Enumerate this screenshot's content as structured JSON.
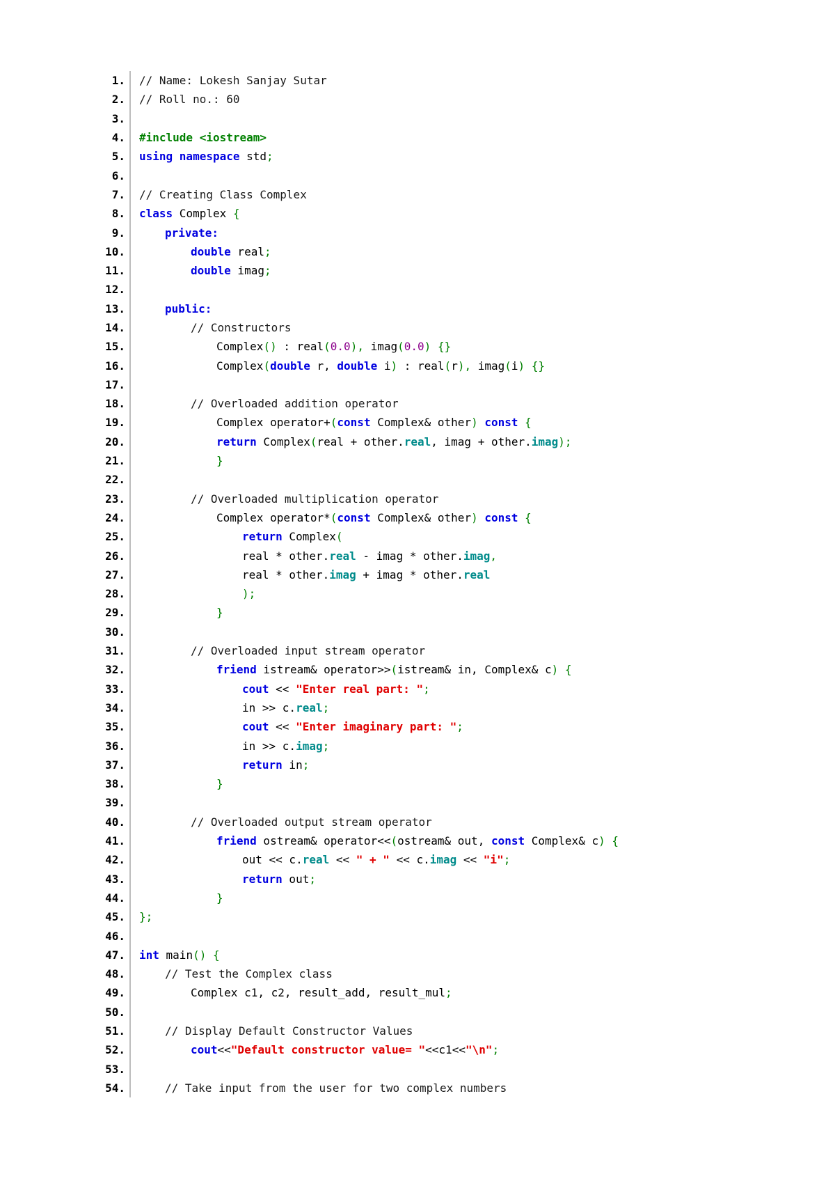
{
  "colors": {
    "plain": "#000000",
    "comment": "#1a1a1a",
    "keyword": "#0000e0",
    "bracket": "#008000",
    "string": "#e00000",
    "number": "#8b008b",
    "member": "#008b8b",
    "directive": "#008000"
  },
  "code": {
    "lines": [
      {
        "n": "1.",
        "indent": 0,
        "tokens": [
          {
            "t": "// Name: Lokesh Sanjay Sutar",
            "c": "comment"
          }
        ]
      },
      {
        "n": "2.",
        "indent": 0,
        "tokens": [
          {
            "t": "// Roll no.: 60",
            "c": "comment"
          }
        ]
      },
      {
        "n": "3.",
        "indent": 0,
        "tokens": []
      },
      {
        "n": "4.",
        "indent": 0,
        "tokens": [
          {
            "t": "#include <iostream>",
            "c": "directive",
            "b": true
          }
        ]
      },
      {
        "n": "5.",
        "indent": 0,
        "tokens": [
          {
            "t": "using namespace",
            "c": "keyword",
            "b": true
          },
          {
            "t": " std",
            "c": "plain"
          },
          {
            "t": ";",
            "c": "bracket"
          }
        ]
      },
      {
        "n": "6.",
        "indent": 0,
        "tokens": []
      },
      {
        "n": "7.",
        "indent": 0,
        "tokens": [
          {
            "t": "// Creating Class Complex",
            "c": "comment"
          }
        ]
      },
      {
        "n": "8.",
        "indent": 0,
        "tokens": [
          {
            "t": "class",
            "c": "keyword",
            "b": true
          },
          {
            "t": " Complex ",
            "c": "plain"
          },
          {
            "t": "{",
            "c": "bracket"
          }
        ]
      },
      {
        "n": "9.",
        "indent": 1,
        "tokens": [
          {
            "t": "private:",
            "c": "keyword",
            "b": true
          }
        ]
      },
      {
        "n": "10.",
        "indent": 2,
        "tokens": [
          {
            "t": "double",
            "c": "keyword",
            "b": true
          },
          {
            "t": " real",
            "c": "plain"
          },
          {
            "t": ";",
            "c": "bracket"
          }
        ]
      },
      {
        "n": "11.",
        "indent": 2,
        "tokens": [
          {
            "t": "double",
            "c": "keyword",
            "b": true
          },
          {
            "t": " imag",
            "c": "plain"
          },
          {
            "t": ";",
            "c": "bracket"
          }
        ]
      },
      {
        "n": "12.",
        "indent": 0,
        "tokens": []
      },
      {
        "n": "13.",
        "indent": 1,
        "tokens": [
          {
            "t": "public:",
            "c": "keyword",
            "b": true
          }
        ]
      },
      {
        "n": "14.",
        "indent": 2,
        "tokens": [
          {
            "t": "// Constructors",
            "c": "comment"
          }
        ]
      },
      {
        "n": "15.",
        "indent": 3,
        "tokens": [
          {
            "t": "Complex",
            "c": "plain"
          },
          {
            "t": "()",
            "c": "bracket"
          },
          {
            "t": " : real",
            "c": "plain"
          },
          {
            "t": "(",
            "c": "bracket"
          },
          {
            "t": "0.0",
            "c": "number"
          },
          {
            "t": "),",
            "c": "bracket"
          },
          {
            "t": " imag",
            "c": "plain"
          },
          {
            "t": "(",
            "c": "bracket"
          },
          {
            "t": "0.0",
            "c": "number"
          },
          {
            "t": ") {}",
            "c": "bracket"
          }
        ]
      },
      {
        "n": "16.",
        "indent": 3,
        "tokens": [
          {
            "t": "Complex",
            "c": "plain"
          },
          {
            "t": "(",
            "c": "bracket"
          },
          {
            "t": "double",
            "c": "keyword",
            "b": true
          },
          {
            "t": " r, ",
            "c": "plain"
          },
          {
            "t": "double",
            "c": "keyword",
            "b": true
          },
          {
            "t": " i",
            "c": "plain"
          },
          {
            "t": ")",
            "c": "bracket"
          },
          {
            "t": " : real",
            "c": "plain"
          },
          {
            "t": "(",
            "c": "bracket"
          },
          {
            "t": "r",
            "c": "plain"
          },
          {
            "t": "),",
            "c": "bracket"
          },
          {
            "t": " imag",
            "c": "plain"
          },
          {
            "t": "(",
            "c": "bracket"
          },
          {
            "t": "i",
            "c": "plain"
          },
          {
            "t": ") {}",
            "c": "bracket"
          }
        ]
      },
      {
        "n": "17.",
        "indent": 0,
        "tokens": []
      },
      {
        "n": "18.",
        "indent": 2,
        "tokens": [
          {
            "t": "// Overloaded addition operator",
            "c": "comment"
          }
        ]
      },
      {
        "n": "19.",
        "indent": 3,
        "tokens": [
          {
            "t": "Complex operator+",
            "c": "plain"
          },
          {
            "t": "(",
            "c": "bracket"
          },
          {
            "t": "const",
            "c": "keyword",
            "b": true
          },
          {
            "t": " Complex& other",
            "c": "plain"
          },
          {
            "t": ")",
            "c": "bracket"
          },
          {
            "t": " ",
            "c": "plain"
          },
          {
            "t": "const",
            "c": "keyword",
            "b": true
          },
          {
            "t": " {",
            "c": "bracket"
          }
        ]
      },
      {
        "n": "20.",
        "indent": 3,
        "tokens": [
          {
            "t": "return",
            "c": "keyword",
            "b": true
          },
          {
            "t": " Complex",
            "c": "plain"
          },
          {
            "t": "(",
            "c": "bracket"
          },
          {
            "t": "real + other.",
            "c": "plain"
          },
          {
            "t": "real",
            "c": "member",
            "b": true
          },
          {
            "t": ", imag + other.",
            "c": "plain"
          },
          {
            "t": "imag",
            "c": "member",
            "b": true
          },
          {
            "t": ");",
            "c": "bracket"
          }
        ]
      },
      {
        "n": "21.",
        "indent": 3,
        "tokens": [
          {
            "t": "}",
            "c": "bracket"
          }
        ]
      },
      {
        "n": "22.",
        "indent": 0,
        "tokens": []
      },
      {
        "n": "23.",
        "indent": 2,
        "tokens": [
          {
            "t": "// Overloaded multiplication operator",
            "c": "comment"
          }
        ]
      },
      {
        "n": "24.",
        "indent": 3,
        "tokens": [
          {
            "t": "Complex operator*",
            "c": "plain"
          },
          {
            "t": "(",
            "c": "bracket"
          },
          {
            "t": "const",
            "c": "keyword",
            "b": true
          },
          {
            "t": " Complex& other",
            "c": "plain"
          },
          {
            "t": ")",
            "c": "bracket"
          },
          {
            "t": " ",
            "c": "plain"
          },
          {
            "t": "const",
            "c": "keyword",
            "b": true
          },
          {
            "t": " {",
            "c": "bracket"
          }
        ]
      },
      {
        "n": "25.",
        "indent": 4,
        "tokens": [
          {
            "t": "return",
            "c": "keyword",
            "b": true
          },
          {
            "t": " Complex",
            "c": "plain"
          },
          {
            "t": "(",
            "c": "bracket"
          }
        ]
      },
      {
        "n": "26.",
        "indent": 4,
        "tokens": [
          {
            "t": "real * other.",
            "c": "plain"
          },
          {
            "t": "real",
            "c": "member",
            "b": true
          },
          {
            "t": " - imag * other.",
            "c": "plain"
          },
          {
            "t": "imag",
            "c": "member",
            "b": true
          },
          {
            "t": ",",
            "c": "bracket"
          }
        ]
      },
      {
        "n": "27.",
        "indent": 4,
        "tokens": [
          {
            "t": "real * other.",
            "c": "plain"
          },
          {
            "t": "imag",
            "c": "member",
            "b": true
          },
          {
            "t": " + imag * other.",
            "c": "plain"
          },
          {
            "t": "real",
            "c": "member",
            "b": true
          }
        ]
      },
      {
        "n": "28.",
        "indent": 4,
        "tokens": [
          {
            "t": ");",
            "c": "bracket"
          }
        ]
      },
      {
        "n": "29.",
        "indent": 3,
        "tokens": [
          {
            "t": "}",
            "c": "bracket"
          }
        ]
      },
      {
        "n": "30.",
        "indent": 0,
        "tokens": []
      },
      {
        "n": "31.",
        "indent": 2,
        "tokens": [
          {
            "t": "// Overloaded input stream operator",
            "c": "comment"
          }
        ]
      },
      {
        "n": "32.",
        "indent": 3,
        "tokens": [
          {
            "t": "friend",
            "c": "keyword",
            "b": true
          },
          {
            "t": " istream& operator>>",
            "c": "plain"
          },
          {
            "t": "(",
            "c": "bracket"
          },
          {
            "t": "istream& in, Complex& c",
            "c": "plain"
          },
          {
            "t": ") {",
            "c": "bracket"
          }
        ]
      },
      {
        "n": "33.",
        "indent": 4,
        "tokens": [
          {
            "t": "cout",
            "c": "keyword",
            "b": true
          },
          {
            "t": " << ",
            "c": "plain"
          },
          {
            "t": "\"Enter real part: \"",
            "c": "string",
            "b": true
          },
          {
            "t": ";",
            "c": "bracket"
          }
        ]
      },
      {
        "n": "34.",
        "indent": 4,
        "tokens": [
          {
            "t": "in >> c.",
            "c": "plain"
          },
          {
            "t": "real",
            "c": "member",
            "b": true
          },
          {
            "t": ";",
            "c": "bracket"
          }
        ]
      },
      {
        "n": "35.",
        "indent": 4,
        "tokens": [
          {
            "t": "cout",
            "c": "keyword",
            "b": true
          },
          {
            "t": " << ",
            "c": "plain"
          },
          {
            "t": "\"Enter imaginary part: \"",
            "c": "string",
            "b": true
          },
          {
            "t": ";",
            "c": "bracket"
          }
        ]
      },
      {
        "n": "36.",
        "indent": 4,
        "tokens": [
          {
            "t": "in >> c.",
            "c": "plain"
          },
          {
            "t": "imag",
            "c": "member",
            "b": true
          },
          {
            "t": ";",
            "c": "bracket"
          }
        ]
      },
      {
        "n": "37.",
        "indent": 4,
        "tokens": [
          {
            "t": "return",
            "c": "keyword",
            "b": true
          },
          {
            "t": " in",
            "c": "plain"
          },
          {
            "t": ";",
            "c": "bracket"
          }
        ]
      },
      {
        "n": "38.",
        "indent": 3,
        "tokens": [
          {
            "t": "}",
            "c": "bracket"
          }
        ]
      },
      {
        "n": "39.",
        "indent": 0,
        "tokens": []
      },
      {
        "n": "40.",
        "indent": 2,
        "tokens": [
          {
            "t": "// Overloaded output stream operator",
            "c": "comment"
          }
        ]
      },
      {
        "n": "41.",
        "indent": 3,
        "tokens": [
          {
            "t": "friend",
            "c": "keyword",
            "b": true
          },
          {
            "t": " ostream& operator<<",
            "c": "plain"
          },
          {
            "t": "(",
            "c": "bracket"
          },
          {
            "t": "ostream& out, ",
            "c": "plain"
          },
          {
            "t": "const",
            "c": "keyword",
            "b": true
          },
          {
            "t": " Complex& c",
            "c": "plain"
          },
          {
            "t": ") {",
            "c": "bracket"
          }
        ]
      },
      {
        "n": "42.",
        "indent": 4,
        "tokens": [
          {
            "t": "out << c.",
            "c": "plain"
          },
          {
            "t": "real",
            "c": "member",
            "b": true
          },
          {
            "t": " << ",
            "c": "plain"
          },
          {
            "t": "\" + \"",
            "c": "string",
            "b": true
          },
          {
            "t": " << c.",
            "c": "plain"
          },
          {
            "t": "imag",
            "c": "member",
            "b": true
          },
          {
            "t": " << ",
            "c": "plain"
          },
          {
            "t": "\"i\"",
            "c": "string",
            "b": true
          },
          {
            "t": ";",
            "c": "bracket"
          }
        ]
      },
      {
        "n": "43.",
        "indent": 4,
        "tokens": [
          {
            "t": "return",
            "c": "keyword",
            "b": true
          },
          {
            "t": " out",
            "c": "plain"
          },
          {
            "t": ";",
            "c": "bracket"
          }
        ]
      },
      {
        "n": "44.",
        "indent": 3,
        "tokens": [
          {
            "t": "}",
            "c": "bracket"
          }
        ]
      },
      {
        "n": "45.",
        "indent": 0,
        "tokens": [
          {
            "t": "};",
            "c": "bracket"
          }
        ]
      },
      {
        "n": "46.",
        "indent": 0,
        "tokens": []
      },
      {
        "n": "47.",
        "indent": 0,
        "tokens": [
          {
            "t": "int",
            "c": "keyword",
            "b": true
          },
          {
            "t": " main",
            "c": "plain"
          },
          {
            "t": "() {",
            "c": "bracket"
          }
        ]
      },
      {
        "n": "48.",
        "indent": 1,
        "tokens": [
          {
            "t": "// Test the Complex class",
            "c": "comment"
          }
        ]
      },
      {
        "n": "49.",
        "indent": 2,
        "tokens": [
          {
            "t": "Complex c1, c2, result_add, result_mul",
            "c": "plain"
          },
          {
            "t": ";",
            "c": "bracket"
          }
        ]
      },
      {
        "n": "50.",
        "indent": 0,
        "tokens": []
      },
      {
        "n": "51.",
        "indent": 1,
        "tokens": [
          {
            "t": "// Display Default Constructor Values",
            "c": "comment"
          }
        ]
      },
      {
        "n": "52.",
        "indent": 2,
        "tokens": [
          {
            "t": "cout",
            "c": "keyword",
            "b": true
          },
          {
            "t": "<<",
            "c": "plain"
          },
          {
            "t": "\"Default constructor value= \"",
            "c": "string",
            "b": true
          },
          {
            "t": "<<c1<<",
            "c": "plain"
          },
          {
            "t": "\"\\n\"",
            "c": "string",
            "b": true
          },
          {
            "t": ";",
            "c": "bracket"
          }
        ]
      },
      {
        "n": "53.",
        "indent": 0,
        "tokens": []
      },
      {
        "n": "54.",
        "indent": 1,
        "tokens": [
          {
            "t": "// Take input from the user for two complex numbers",
            "c": "comment"
          }
        ]
      }
    ]
  }
}
